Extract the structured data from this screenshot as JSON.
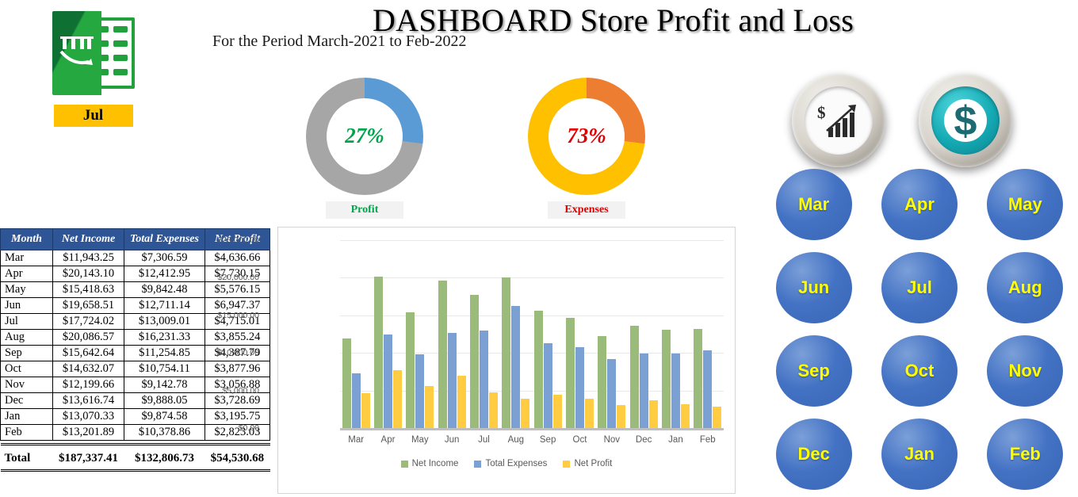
{
  "header": {
    "title": "DASHBOARD  Store Profit and Loss",
    "subtitle": "For the Period March-2021 to Feb-2022",
    "excel_icon": "excel-workbook-icon",
    "selected_month_badge": "Jul"
  },
  "kpis": [
    {
      "id": "profit",
      "value": "27%",
      "caption": "Profit",
      "percent": 27,
      "ring_color": "#5B9BD5",
      "track_color": "#A6A6A6",
      "text_color": "#00A44B"
    },
    {
      "id": "expense",
      "value": "73%",
      "caption": "Expenses",
      "percent": 27,
      "ring_color": "#ED7D31",
      "track_color": "#FFC000",
      "text_color": "#E00000"
    }
  ],
  "badges": [
    {
      "id": "growth",
      "icon": "growth-chart-dollar-icon"
    },
    {
      "id": "dollar",
      "icon": "dollar-sign-icon"
    }
  ],
  "table": {
    "headers": [
      "Month",
      "Net Income",
      "Total Expenses",
      "Net Profit"
    ],
    "rows": [
      [
        "Mar",
        "$11,943.25",
        "$7,306.59",
        "$4,636.66"
      ],
      [
        "Apr",
        "$20,143.10",
        "$12,412.95",
        "$7,730.15"
      ],
      [
        "May",
        "$15,418.63",
        "$9,842.48",
        "$5,576.15"
      ],
      [
        "Jun",
        "$19,658.51",
        "$12,711.14",
        "$6,947.37"
      ],
      [
        "Jul",
        "$17,724.02",
        "$13,009.01",
        "$4,715.01"
      ],
      [
        "Aug",
        "$20,086.57",
        "$16,231.33",
        "$3,855.24"
      ],
      [
        "Sep",
        "$15,642.64",
        "$11,254.85",
        "$4,387.79"
      ],
      [
        "Oct",
        "$14,632.07",
        "$10,754.11",
        "$3,877.96"
      ],
      [
        "Nov",
        "$12,199.66",
        "$9,142.78",
        "$3,056.88"
      ],
      [
        "Dec",
        "$13,616.74",
        "$9,888.05",
        "$3,728.69"
      ],
      [
        "Jan",
        "$13,070.33",
        "$9,874.58",
        "$3,195.75"
      ],
      [
        "Feb",
        "$13,201.89",
        "$10,378.86",
        "$2,823.03"
      ]
    ],
    "total_row": [
      "Total",
      "$187,337.41",
      "$132,806.73",
      "$54,530.68"
    ]
  },
  "month_buttons": [
    "Mar",
    "Apr",
    "May",
    "Jun",
    "Jul",
    "Aug",
    "Sep",
    "Oct",
    "Nov",
    "Dec",
    "Jan",
    "Feb"
  ],
  "chart_data": {
    "type": "bar",
    "title": "",
    "xlabel": "",
    "ylabel": "",
    "categories": [
      "Mar",
      "Apr",
      "May",
      "Jun",
      "Jul",
      "Aug",
      "Sep",
      "Oct",
      "Nov",
      "Dec",
      "Jan",
      "Feb"
    ],
    "series": [
      {
        "name": "Net Income",
        "color": "#9BBB7A",
        "values": [
          11943.25,
          20143.1,
          15418.63,
          19658.51,
          17724.02,
          20086.57,
          15642.64,
          14632.07,
          12199.66,
          13616.74,
          13070.33,
          13201.89
        ]
      },
      {
        "name": "Total Expenses",
        "color": "#7BA0D4",
        "values": [
          7306.59,
          12412.95,
          9842.48,
          12711.14,
          13009.01,
          16231.33,
          11254.85,
          10754.11,
          9142.78,
          9888.05,
          9874.58,
          10378.86
        ]
      },
      {
        "name": "Net Profit",
        "color": "#FFCC42",
        "values": [
          4636.66,
          7730.15,
          5576.15,
          6947.37,
          4715.01,
          3855.24,
          4387.79,
          3877.96,
          3056.88,
          3728.69,
          3195.75,
          2823.03
        ]
      }
    ],
    "ylim": [
      0,
      25000
    ],
    "yticks": [
      "$0.00",
      "$5,000.00",
      "$10,000.00",
      "$15,000.00",
      "$20,000.00",
      "$25,000.00"
    ],
    "ytick_values": [
      0,
      5000,
      10000,
      15000,
      20000,
      25000
    ],
    "grid": true,
    "legend_position": "bottom"
  }
}
